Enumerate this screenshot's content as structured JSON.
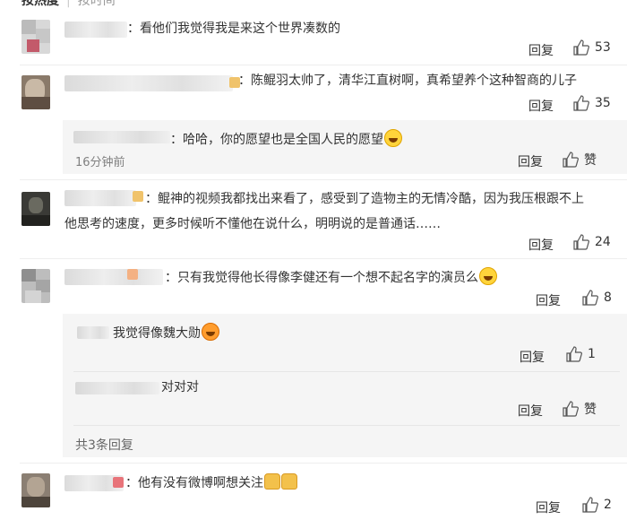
{
  "tabs": {
    "hot": "按热度",
    "time": "按时间"
  },
  "comments": [
    {
      "text": "：看他们我觉得我是来这个世界凑数的",
      "reply": "回复",
      "likes": "53"
    },
    {
      "text": "：陈鲲羽太帅了，清华江直树啊，真希望养个这种智商的儿子",
      "reply": "回复",
      "likes": "35",
      "replies": [
        {
          "text": "：哈哈，你的愿望也是全国人民的愿望",
          "time": "16分钟前",
          "reply": "回复",
          "likes": "赞"
        }
      ]
    },
    {
      "text": "：鲲神的视频我都找出来看了，感受到了造物主的无情冷酷，因为我压根跟不上他思考的速度，更多时候听不懂他在说什么，明明说的是普通话……",
      "reply": "回复",
      "likes": "24"
    },
    {
      "text": "：只有我觉得他长得像李健还有一个想不起名字的演员么",
      "reply": "回复",
      "likes": "8",
      "replies": [
        {
          "text": "我觉得像魏大勋",
          "reply": "回复",
          "likes": "1"
        },
        {
          "text": "对对对",
          "reply": "回复",
          "likes": "赞"
        }
      ],
      "more": "共3条回复"
    },
    {
      "text": "：他有没有微博啊想关注",
      "reply": "回复",
      "likes": "2"
    }
  ],
  "icons": {
    "like": "thumbs-up-icon",
    "laugh": "laughing-emoji-icon",
    "thumb": "thumbs-up-emoji-icon",
    "grin": "grinning-emoji-icon"
  }
}
